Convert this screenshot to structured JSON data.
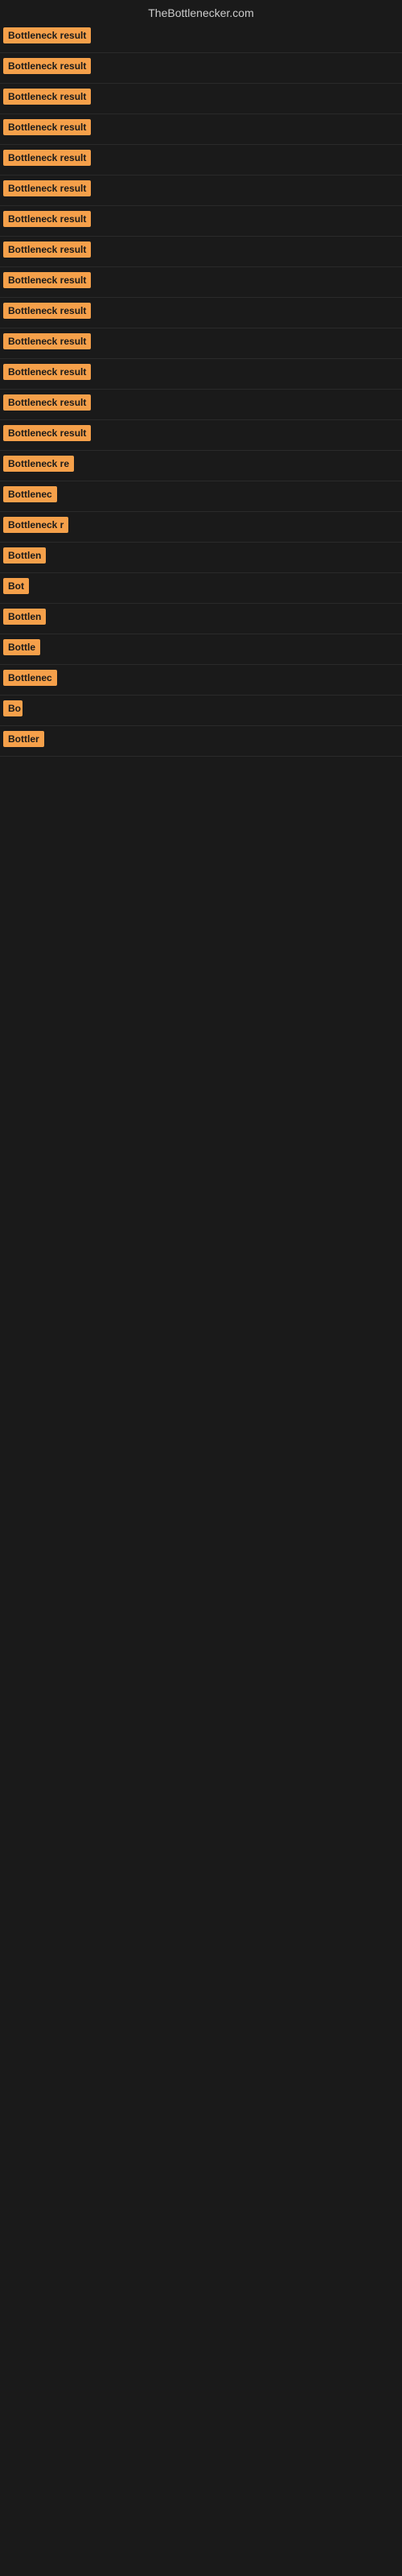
{
  "header": {
    "title": "TheBottlenecker.com"
  },
  "rows": [
    {
      "label": "Bottleneck result",
      "width": 115
    },
    {
      "label": "Bottleneck result",
      "width": 115
    },
    {
      "label": "Bottleneck result",
      "width": 115
    },
    {
      "label": "Bottleneck result",
      "width": 115
    },
    {
      "label": "Bottleneck result",
      "width": 115
    },
    {
      "label": "Bottleneck result",
      "width": 115
    },
    {
      "label": "Bottleneck result",
      "width": 115
    },
    {
      "label": "Bottleneck result",
      "width": 115
    },
    {
      "label": "Bottleneck result",
      "width": 115
    },
    {
      "label": "Bottleneck result",
      "width": 115
    },
    {
      "label": "Bottleneck result",
      "width": 115
    },
    {
      "label": "Bottleneck result",
      "width": 115
    },
    {
      "label": "Bottleneck result",
      "width": 115
    },
    {
      "label": "Bottleneck result",
      "width": 115
    },
    {
      "label": "Bottleneck re",
      "width": 90
    },
    {
      "label": "Bottlenec",
      "width": 72
    },
    {
      "label": "Bottleneck r",
      "width": 82
    },
    {
      "label": "Bottlen",
      "width": 58
    },
    {
      "label": "Bot",
      "width": 32
    },
    {
      "label": "Bottlen",
      "width": 58
    },
    {
      "label": "Bottle",
      "width": 48
    },
    {
      "label": "Bottlenec",
      "width": 72
    },
    {
      "label": "Bo",
      "width": 24
    },
    {
      "label": "Bottler",
      "width": 52
    }
  ]
}
